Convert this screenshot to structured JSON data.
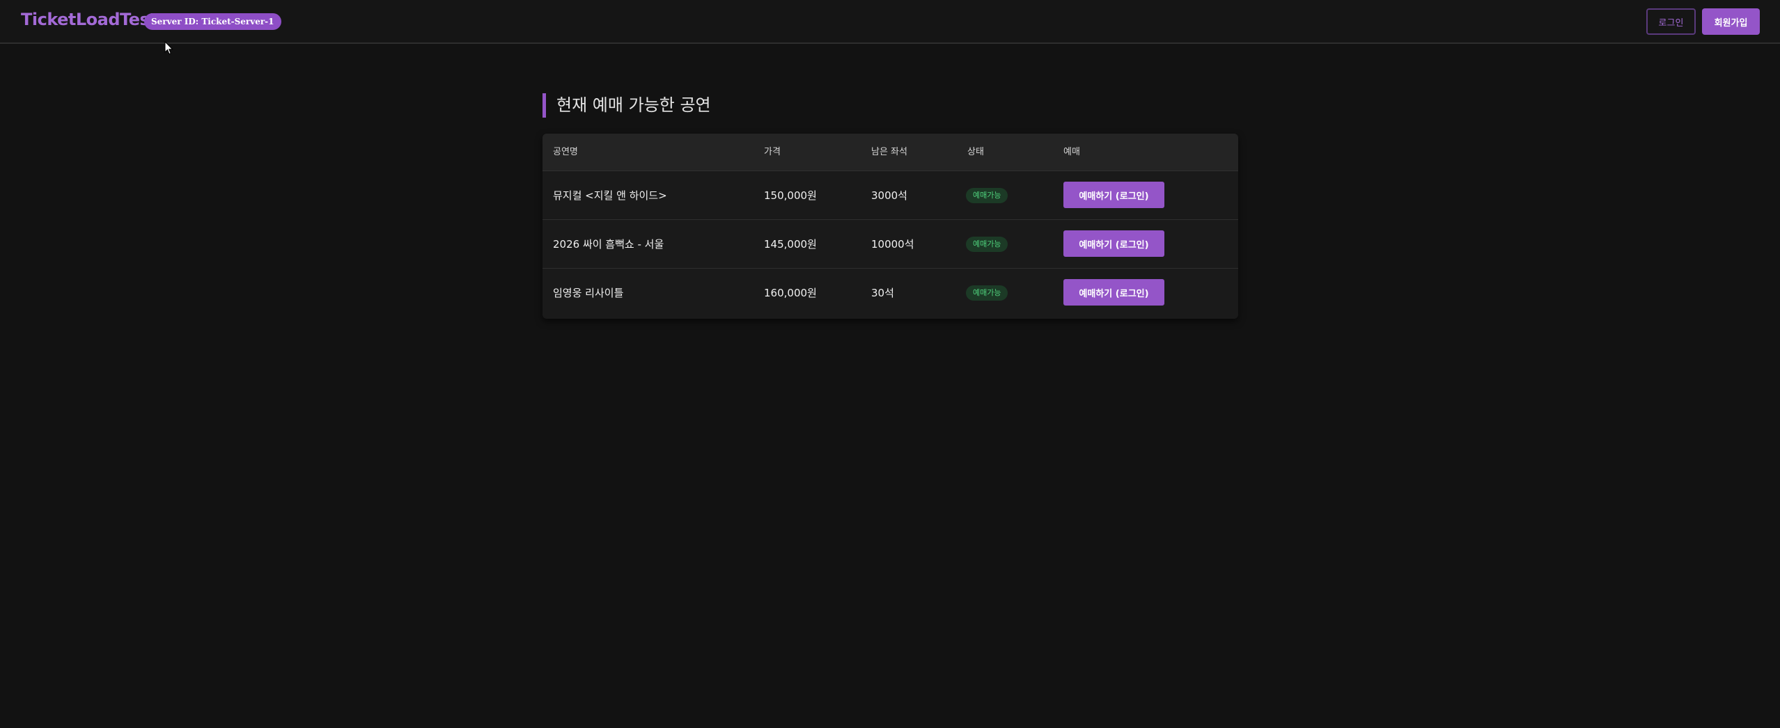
{
  "header": {
    "logo": "TicketLoadTest",
    "server_badge": "Server ID: Ticket-Server-1",
    "login_label": "로그인",
    "signup_label": "회원가입"
  },
  "section": {
    "title": "현재 예매 가능한 공연"
  },
  "table": {
    "columns": [
      "공연명",
      "가격",
      "남은 좌석",
      "상태",
      "예매"
    ],
    "rows": [
      {
        "name": "뮤지컬 <지킬 앤 하이드>",
        "price": "150,000원",
        "seats": "3000석",
        "status": "예매가능",
        "action": "예매하기 (로그인)"
      },
      {
        "name": "2026 싸이 흠뻑쇼 - 서울",
        "price": "145,000원",
        "seats": "10000석",
        "status": "예매가능",
        "action": "예매하기 (로그인)"
      },
      {
        "name": "임영웅 리사이틀",
        "price": "160,000원",
        "seats": "30석",
        "status": "예매가능",
        "action": "예매하기 (로그인)"
      }
    ]
  },
  "colors": {
    "accent": "#9455c8",
    "logo": "#a36ad6",
    "status_text": "#4fd17c",
    "status_bg": "#1c3a26",
    "background": "#121212"
  },
  "icons": {
    "cursor": "mouse-cursor-icon"
  }
}
